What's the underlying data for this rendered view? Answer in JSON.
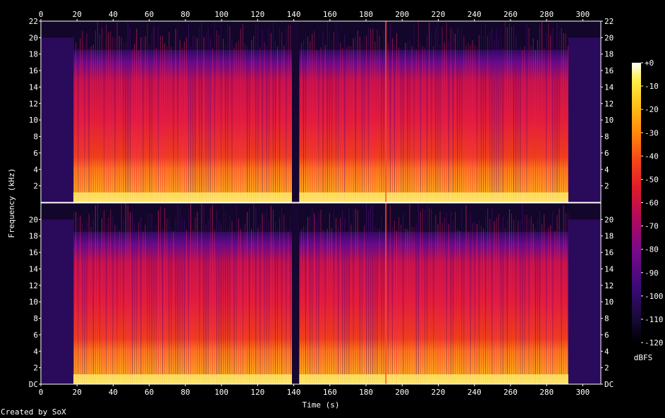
{
  "chart_data": {
    "type": "heatmap",
    "title": "",
    "xlabel": "Time (s)",
    "ylabel": "Frequency (kHz)",
    "xlim": [
      0,
      310
    ],
    "ylim": [
      0,
      22
    ],
    "x_ticks": [
      "0",
      "20",
      "40",
      "60",
      "80",
      "100",
      "120",
      "140",
      "160",
      "180",
      "200",
      "220",
      "240",
      "260",
      "280",
      "300"
    ],
    "y_ticks": [
      "DC",
      "2",
      "4",
      "6",
      "8",
      "10",
      "12",
      "14",
      "16",
      "18",
      "20",
      "22"
    ],
    "channels": [
      {
        "name": "top",
        "freq_ticks": [
          "2",
          "4",
          "6",
          "8",
          "10",
          "12",
          "14",
          "16",
          "18",
          "20",
          "22"
        ]
      },
      {
        "name": "bottom",
        "freq_ticks": [
          "DC",
          "2",
          "4",
          "6",
          "8",
          "10",
          "12",
          "14",
          "16",
          "18",
          "20"
        ]
      }
    ],
    "colorbar": {
      "label": "dBFS",
      "range": [
        -120,
        0
      ],
      "ticks": [
        "+0",
        "-10",
        "-20",
        "-30",
        "-40",
        "-50",
        "-60",
        "-70",
        "-80",
        "-90",
        "-100",
        "-110",
        "-120"
      ],
      "colors": [
        "#000000",
        "#1a0a3c",
        "#3c0a78",
        "#7a0a8a",
        "#b30a5a",
        "#e01a2a",
        "#f5461a",
        "#ff8a0a",
        "#ffc21a",
        "#fff04a",
        "#ffffd2",
        "#ffffff"
      ]
    },
    "events": {
      "lead_in_end_s": 18,
      "gap_start_s": 139,
      "gap_end_s": 143,
      "click_s": 191,
      "fade_start_s": 292,
      "end_s": 310
    }
  },
  "footer": {
    "credit": "Created by SoX"
  }
}
